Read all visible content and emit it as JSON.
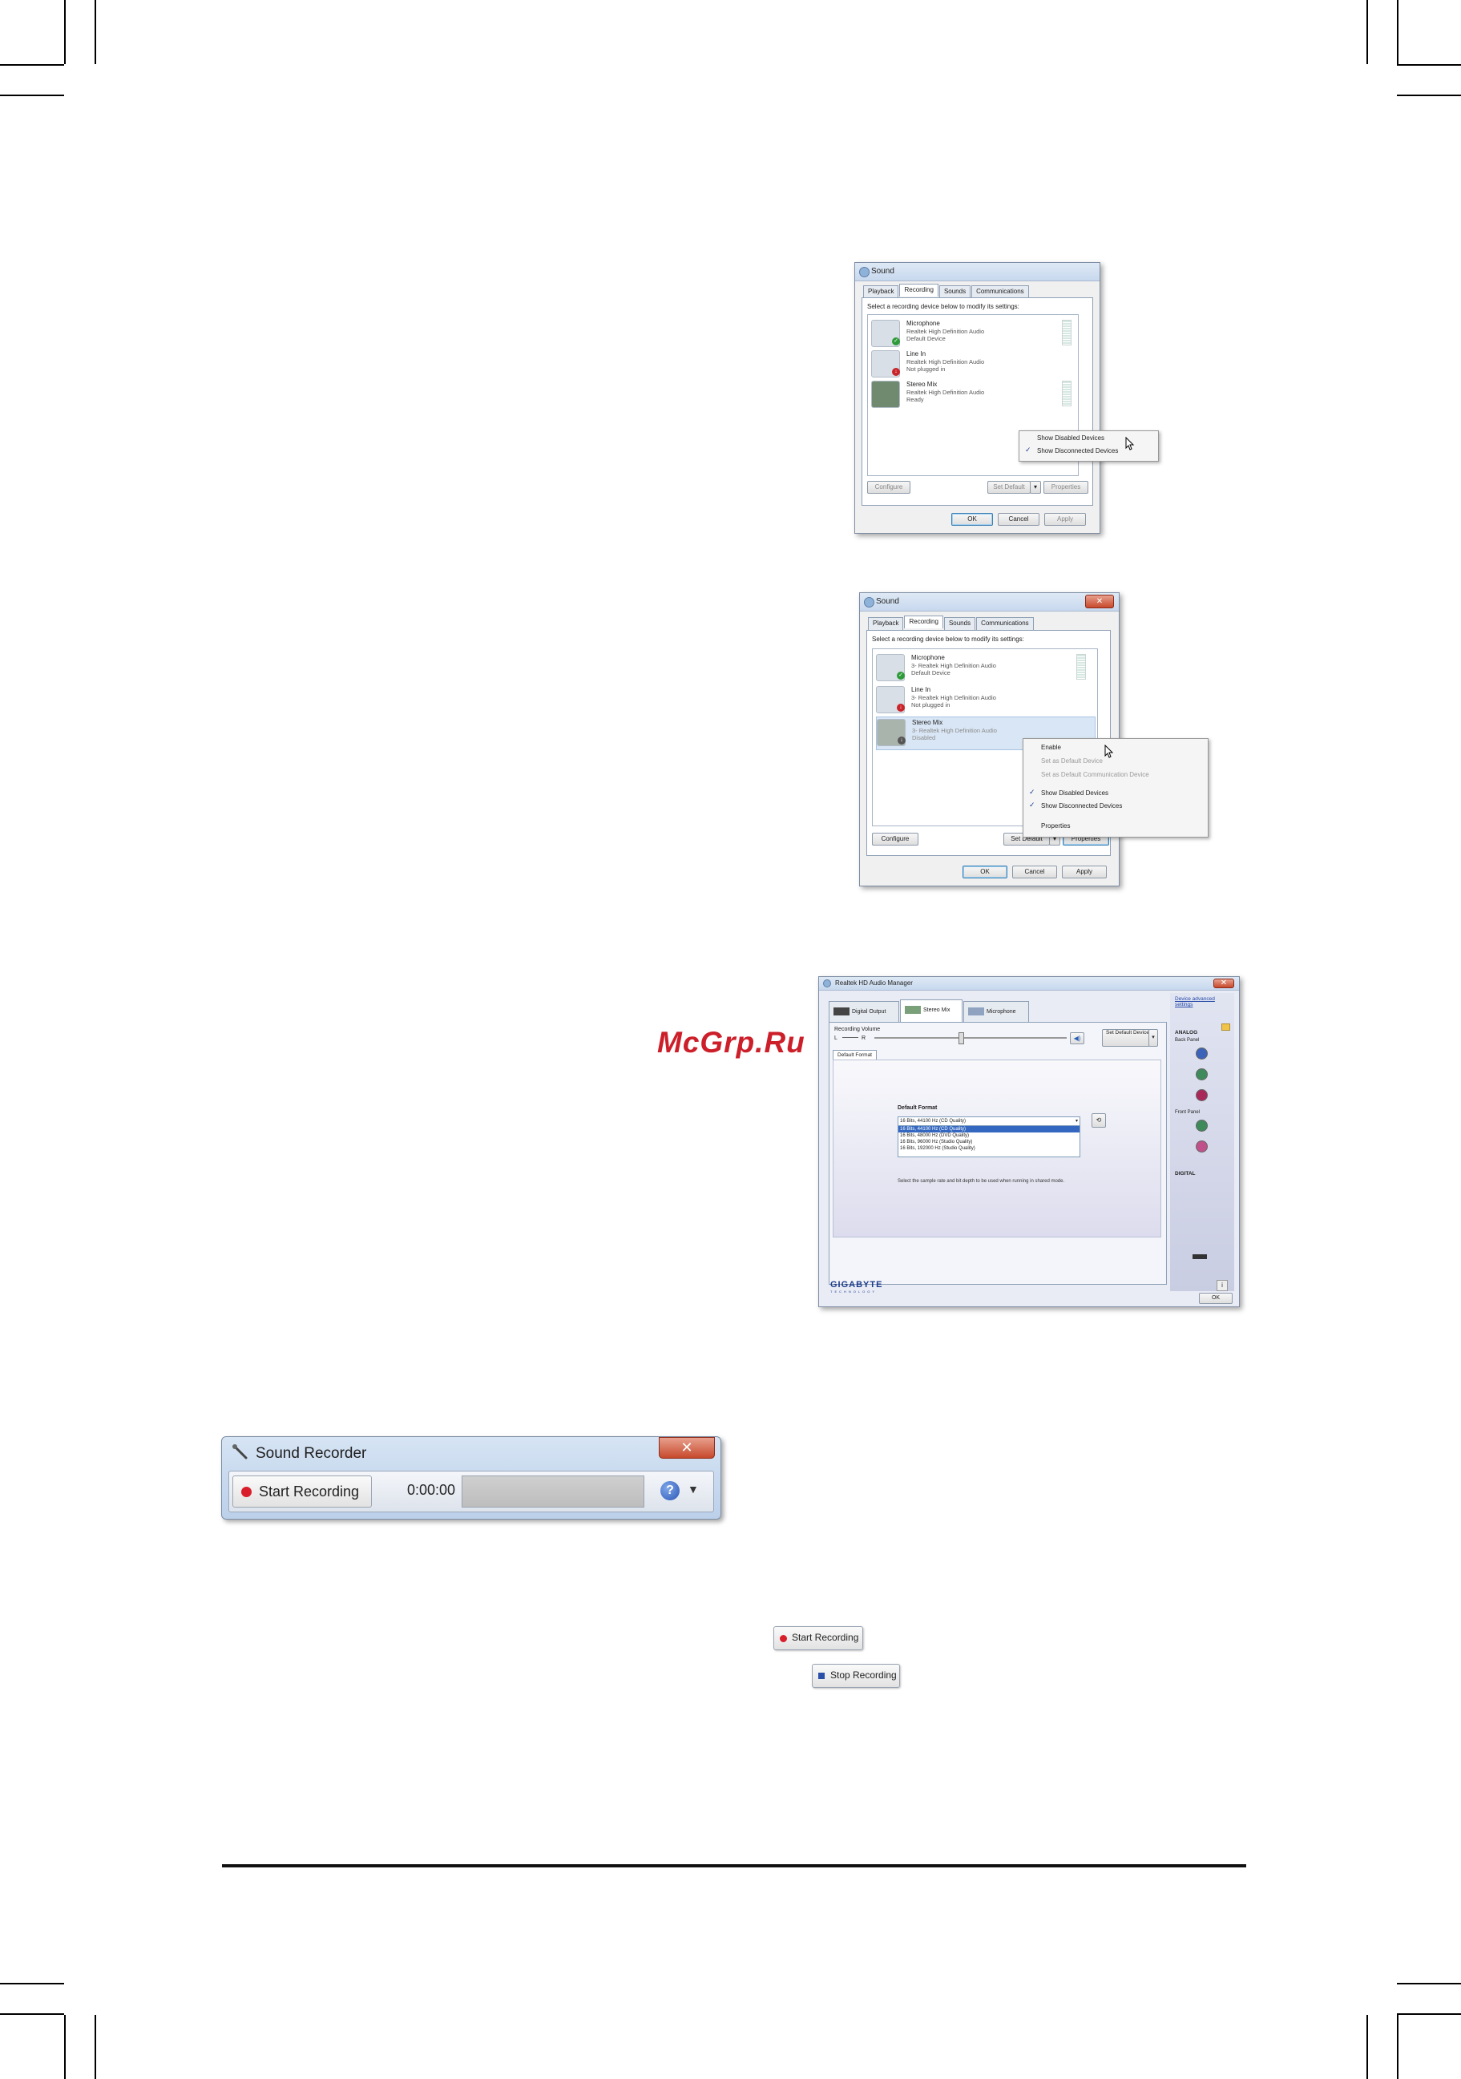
{
  "watermark": "McGrp.Ru",
  "sound_dialog_1": {
    "title": "Sound",
    "tabs": [
      "Playback",
      "Recording",
      "Sounds",
      "Communications"
    ],
    "active_tab": "Recording",
    "instruction": "Select a recording device below to modify its settings:",
    "devices": [
      {
        "name": "Microphone",
        "driver": "Realtek High Definition Audio",
        "status": "Default Device",
        "icon": "microphone-icon",
        "badge": "check"
      },
      {
        "name": "Line In",
        "driver": "Realtek High Definition Audio",
        "status": "Not plugged in",
        "icon": "line-in-icon",
        "badge": "down-arrow"
      },
      {
        "name": "Stereo Mix",
        "driver": "Realtek High Definition Audio",
        "status": "Ready",
        "icon": "stereo-mix-icon",
        "badge": ""
      }
    ],
    "context_menu": [
      {
        "label": "Show Disabled Devices",
        "checked": false
      },
      {
        "label": "Show Disconnected Devices",
        "checked": true
      }
    ],
    "buttons": {
      "configure": "Configure",
      "set_default": "Set Default",
      "properties": "Properties",
      "ok": "OK",
      "cancel": "Cancel",
      "apply": "Apply"
    }
  },
  "sound_dialog_2": {
    "title": "Sound",
    "tabs": [
      "Playback",
      "Recording",
      "Sounds",
      "Communications"
    ],
    "active_tab": "Recording",
    "instruction": "Select a recording device below to modify its settings:",
    "devices": [
      {
        "name": "Microphone",
        "driver": "3- Realtek High Definition Audio",
        "status": "Default Device",
        "icon": "microphone-icon",
        "badge": "check"
      },
      {
        "name": "Line In",
        "driver": "3- Realtek High Definition Audio",
        "status": "Not plugged in",
        "icon": "line-in-icon",
        "badge": "down-arrow"
      },
      {
        "name": "Stereo Mix",
        "driver": "3- Realtek High Definition Audio",
        "status": "Disabled",
        "icon": "stereo-mix-icon",
        "badge": "disabled"
      }
    ],
    "context_menu": [
      {
        "label": "Enable",
        "checked": false,
        "enabled": true
      },
      {
        "label": "Set as Default Device",
        "checked": false,
        "enabled": false
      },
      {
        "label": "Set as Default Communication Device",
        "checked": false,
        "enabled": false
      },
      {
        "label": "Show Disabled Devices",
        "checked": true,
        "enabled": true
      },
      {
        "label": "Show Disconnected Devices",
        "checked": true,
        "enabled": true
      },
      {
        "label": "Properties",
        "checked": false,
        "enabled": true
      }
    ],
    "buttons": {
      "configure": "Configure",
      "set_default": "Set Default",
      "properties": "Properties",
      "ok": "OK",
      "cancel": "Cancel",
      "apply": "Apply"
    }
  },
  "realtek": {
    "title": "Realtek HD Audio Manager",
    "tabs": [
      "Digital Output",
      "Stereo Mix",
      "Microphone"
    ],
    "active_tab": "Stereo Mix",
    "recording_volume_label": "Recording Volume",
    "l_label": "L",
    "r_label": "R",
    "volume_level": 0.45,
    "set_default_label": "Set Default Device",
    "subtab": "Default Format",
    "default_format_label": "Default Format",
    "format_selected": "16 Bits, 44100 Hz (CD Quality)",
    "format_options": [
      "16 Bits, 44100 Hz (CD Quality)",
      "16 Bits, 48000 Hz (DVD Quality)",
      "16 Bits, 96000 Hz (Studio Quality)",
      "16 Bits, 192000 Hz (Studio Quality)"
    ],
    "description": "Select the sample rate and bit depth to be used when running in shared mode.",
    "side": {
      "advanced_link": "Device advanced settings",
      "analog": "ANALOG",
      "back_panel": "Back Panel",
      "front_panel": "Front Panel",
      "digital": "DIGITAL"
    },
    "jack_colors": {
      "back": [
        "#3b63b8",
        "#3e8a5a",
        "#a8285a"
      ],
      "front": [
        "#3e8a5a",
        "#c0508a"
      ]
    },
    "brand": "GIGABYTE",
    "brand_sub": "TECHNOLOGY",
    "ok": "OK"
  },
  "sound_recorder": {
    "title": "Sound Recorder",
    "start_label": "Start Recording",
    "time": "0:00:00"
  },
  "start_recording_button": "Start Recording",
  "stop_recording_button": "Stop Recording"
}
